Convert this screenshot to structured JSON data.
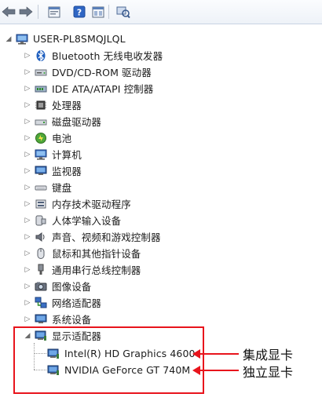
{
  "toolbar": {
    "buttons": [
      "back-icon",
      "forward-icon",
      "properties-icon",
      "help-icon",
      "view-icon",
      "scan-hardware-icon"
    ]
  },
  "tree": {
    "root": "USER-PL8SMQJLQL",
    "items": [
      {
        "label": "Bluetooth 无线电收发器",
        "icon": "bluetooth-icon"
      },
      {
        "label": "DVD/CD-ROM 驱动器",
        "icon": "dvd-drive-icon"
      },
      {
        "label": "IDE ATA/ATAPI 控制器",
        "icon": "ide-controller-icon"
      },
      {
        "label": "处理器",
        "icon": "processor-icon"
      },
      {
        "label": "磁盘驱动器",
        "icon": "disk-drive-icon"
      },
      {
        "label": "电池",
        "icon": "battery-icon"
      },
      {
        "label": "计算机",
        "icon": "computer-icon"
      },
      {
        "label": "监视器",
        "icon": "monitor-icon"
      },
      {
        "label": "键盘",
        "icon": "keyboard-icon"
      },
      {
        "label": "内存技术驱动程序",
        "icon": "memory-tech-icon"
      },
      {
        "label": "人体学输入设备",
        "icon": "hid-icon"
      },
      {
        "label": "声音、视频和游戏控制器",
        "icon": "sound-icon"
      },
      {
        "label": "鼠标和其他指针设备",
        "icon": "mouse-icon"
      },
      {
        "label": "通用串行总线控制器",
        "icon": "usb-icon"
      },
      {
        "label": "图像设备",
        "icon": "imaging-icon"
      },
      {
        "label": "网络适配器",
        "icon": "network-adapter-icon"
      },
      {
        "label": "系统设备",
        "icon": "system-device-icon"
      },
      {
        "label": "显示适配器",
        "icon": "display-adapter-icon"
      }
    ],
    "display_children": [
      "Intel(R) HD Graphics 4600",
      "NVIDIA GeForce GT 740M"
    ]
  },
  "annotations": {
    "integrated": "集成显卡",
    "dedicated": "独立显卡"
  },
  "colors": {
    "annotation_red": "#e8141c",
    "accent_blue": "#1f5fbf"
  }
}
